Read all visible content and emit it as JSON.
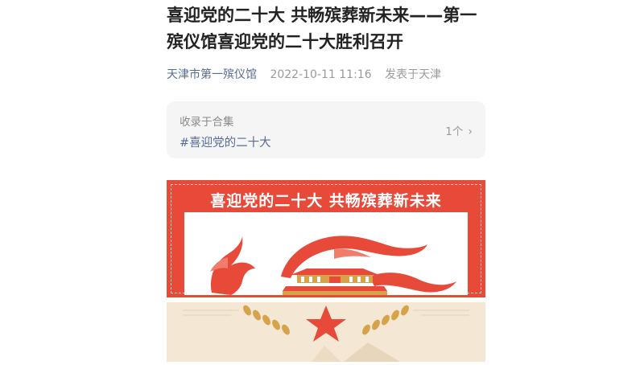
{
  "article": {
    "title": "喜迎党的二十大 共畅殡葬新未来——第一殡仪馆喜迎党的二十大胜利召开",
    "author": "天津市第一殡仪馆",
    "datetime": "2022-10-11 11:16",
    "location": "发表于天津"
  },
  "collection": {
    "label": "收录于合集",
    "tag": "#喜迎党的二十大",
    "count": "1个",
    "chevron_icon": "chevron-right-icon"
  },
  "banner": {
    "title": "喜迎党的二十大 共畅殡葬新未来",
    "icons": [
      "dove-icon",
      "red-ribbon-icon",
      "tiananmen-icon",
      "wheat-ear-icon",
      "star-icon"
    ],
    "colors": {
      "red": "#e84a3a",
      "beige": "#f4e7d4",
      "gold": "#d6a24a"
    }
  }
}
